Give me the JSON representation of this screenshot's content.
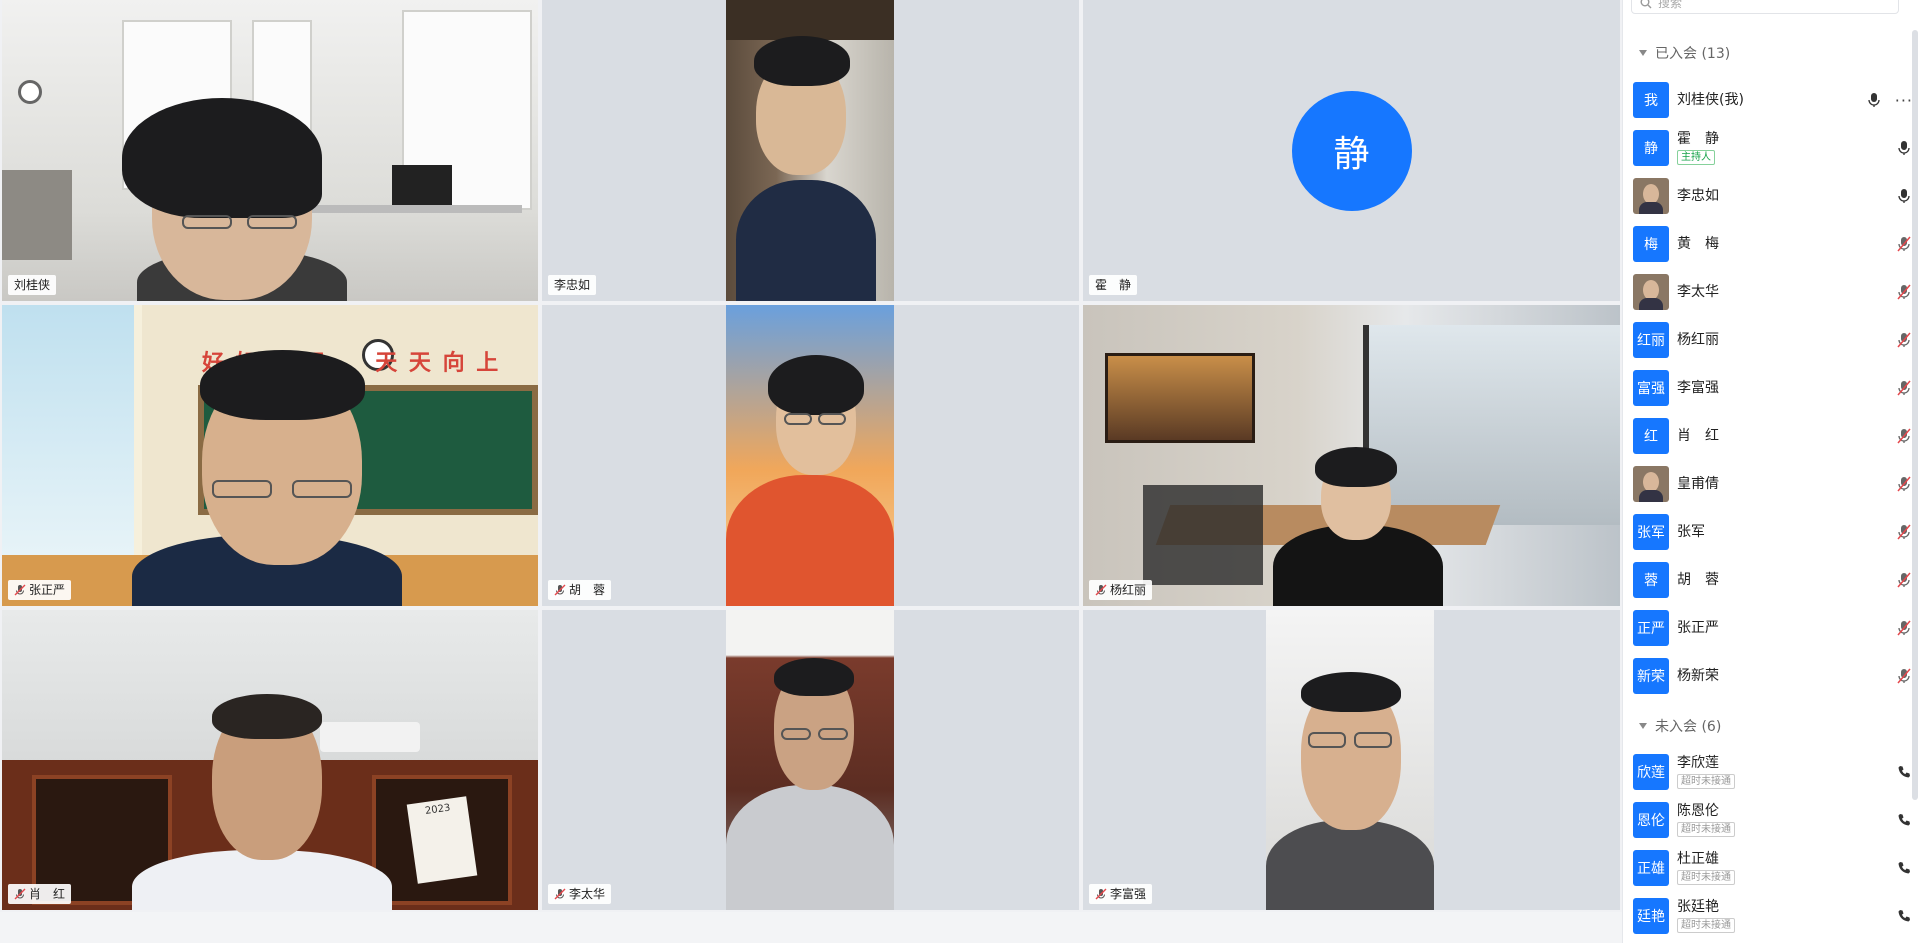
{
  "grid": {
    "tiles": [
      {
        "name": "刘桂侠",
        "muted": false,
        "active": true
      },
      {
        "name": "李忠如",
        "muted": false,
        "active": false
      },
      {
        "name": "霍　静",
        "muted": false,
        "active": false,
        "avatar_char": "静"
      },
      {
        "name": "张正严",
        "muted": true,
        "active": false
      },
      {
        "name": "胡　蓉",
        "muted": true,
        "active": false
      },
      {
        "name": "杨红丽",
        "muted": true,
        "active": false
      },
      {
        "name": "肖　红",
        "muted": true,
        "active": false
      },
      {
        "name": "李太华",
        "muted": true,
        "active": false
      },
      {
        "name": "李富强",
        "muted": true,
        "active": false
      }
    ],
    "classroom_banner": "好 好 学 习     天 天 向 上",
    "calendar_text": "2023"
  },
  "panel": {
    "search_placeholder": "搜索",
    "joined_label": "已入会 (13)",
    "not_joined_label": "未入会 (6)",
    "joined": [
      {
        "avatar": "我",
        "name": "刘桂侠(我)",
        "icon": "mic",
        "more": "···"
      },
      {
        "avatar": "静",
        "name": "霍　静",
        "badge": "主持人",
        "icon": "mic"
      },
      {
        "avatar": "",
        "photo": true,
        "name": "李忠如",
        "icon": "mic"
      },
      {
        "avatar": "梅",
        "name": "黄　梅",
        "icon": "mic-muted"
      },
      {
        "avatar": "",
        "photo": true,
        "name": "李太华",
        "icon": "mic-muted"
      },
      {
        "avatar": "红丽",
        "name": "杨红丽",
        "icon": "mic-muted"
      },
      {
        "avatar": "富强",
        "name": "李富强",
        "icon": "mic-muted"
      },
      {
        "avatar": "红",
        "name": "肖　红",
        "icon": "mic-muted"
      },
      {
        "avatar": "",
        "photo": true,
        "name": "皇甫倩",
        "icon": "mic-muted"
      },
      {
        "avatar": "张军",
        "name": "张军",
        "icon": "mic-muted"
      },
      {
        "avatar": "蓉",
        "name": "胡　蓉",
        "icon": "mic-muted"
      },
      {
        "avatar": "正严",
        "name": "张正严",
        "icon": "mic-muted"
      },
      {
        "avatar": "新荣",
        "name": "杨新荣",
        "icon": "mic-muted"
      }
    ],
    "not_joined": [
      {
        "avatar": "欣莲",
        "name": "李欣莲",
        "badge": "超时未接通",
        "icon": "phone"
      },
      {
        "avatar": "恩伦",
        "name": "陈恩伦",
        "badge": "超时未接通",
        "icon": "phone"
      },
      {
        "avatar": "正雄",
        "name": "杜正雄",
        "badge": "超时未接通",
        "icon": "phone"
      },
      {
        "avatar": "廷艳",
        "name": "张廷艳",
        "badge": "超时未接通",
        "icon": "phone"
      }
    ]
  },
  "colors": {
    "accent": "#1677ff",
    "active_border": "#2ca24a",
    "host_badge": "#16a34a"
  }
}
